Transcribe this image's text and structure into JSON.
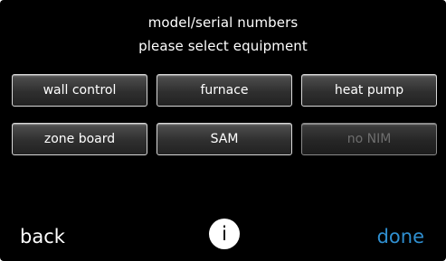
{
  "header": {
    "title": "model/serial numbers",
    "subtitle": "please select equipment"
  },
  "equipment_buttons": [
    {
      "label": "wall control",
      "enabled": true
    },
    {
      "label": "furnace",
      "enabled": true
    },
    {
      "label": "heat pump",
      "enabled": true
    },
    {
      "label": "zone board",
      "enabled": true
    },
    {
      "label": "SAM",
      "enabled": true
    },
    {
      "label": "no NIM",
      "enabled": false
    }
  ],
  "footer": {
    "back_label": "back",
    "info_glyph": "i",
    "done_label": "done"
  },
  "colors": {
    "background": "#000000",
    "done_accent": "#2f8fd0",
    "disabled_text": "#6e6e6e"
  }
}
